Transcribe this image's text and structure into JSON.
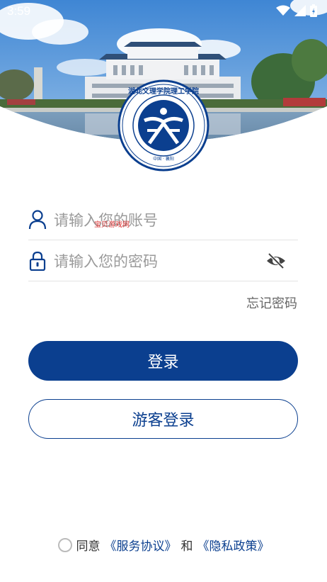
{
  "status": {
    "time": "3:59"
  },
  "logo": {
    "name": "湖北文理学院理工学院",
    "english": "Science and Technology College of Hubei University of Arts and Science",
    "place": "中国 · 襄阳"
  },
  "watermark": "宝贝游戏网",
  "login": {
    "account_placeholder": "请输入您的账号",
    "password_placeholder": "请输入您的密码",
    "forgot": "忘记密码",
    "login_button": "登录",
    "guest_button": "游客登录"
  },
  "agreement": {
    "agree": "同意",
    "service": "《服务协议》",
    "and": "和",
    "privacy": "《隐私政策》"
  },
  "colors": {
    "primary": "#0b3f8f",
    "accent": "#0b3f8f"
  }
}
